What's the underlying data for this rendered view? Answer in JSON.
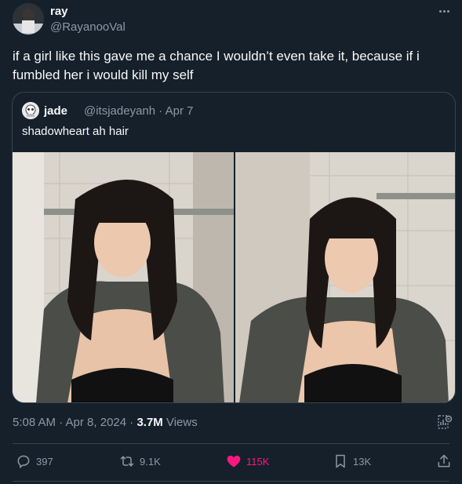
{
  "author": {
    "display_name": "ray",
    "handle": "@RayanooVal",
    "avatar_icon": "avatar-photo"
  },
  "tweet": {
    "text": "if a girl like this gave me a chance I wouldn’t even take it, because if i fumbled her i would kill my self"
  },
  "quoted": {
    "display_name": "jade",
    "handle": "@itsjadeyanh · Apr 7",
    "text": "shadowheart ah hair",
    "media_count": 2
  },
  "meta": {
    "time": "5:08 AM · Apr 8, 2024 · ",
    "views_count": "3.7M",
    "views_label": " Views"
  },
  "actions": {
    "replies": "397",
    "retweets": "9.1K",
    "likes": "115K",
    "bookmarks": "13K"
  },
  "colors": {
    "background": "#15202b",
    "secondary_text": "#8b98a5",
    "like_active": "#f91880",
    "border": "#38444d"
  }
}
